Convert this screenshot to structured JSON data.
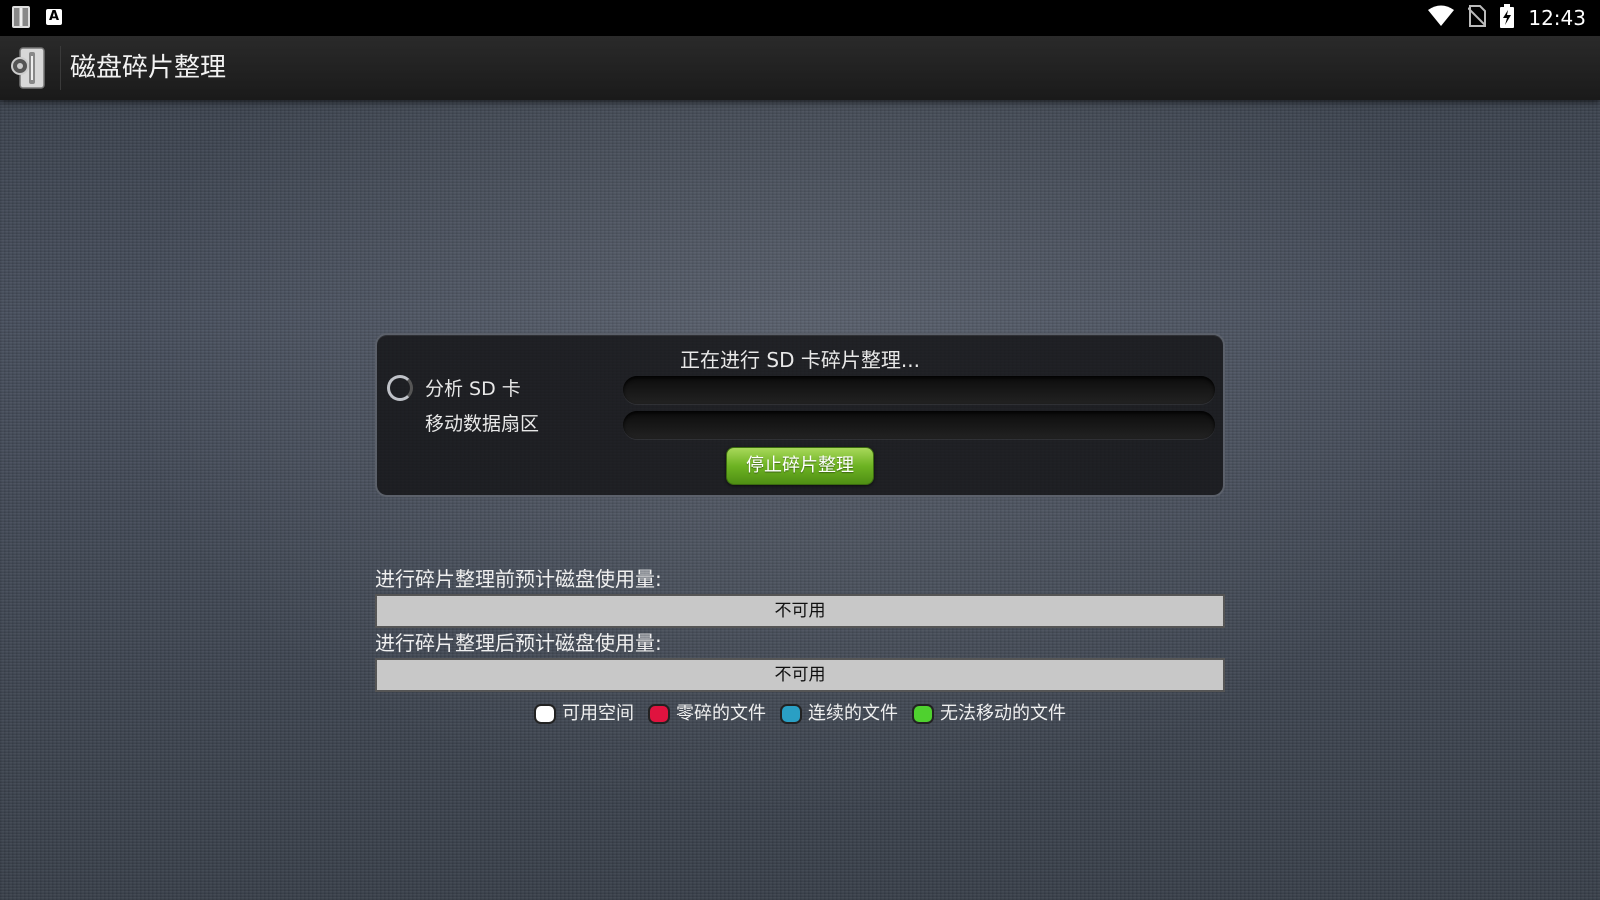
{
  "status_bar": {
    "time": "12:43",
    "left_icons": [
      "defrag-app-icon",
      "keyboard-a-icon"
    ],
    "right_icons": [
      "wifi-icon",
      "no-sim-icon",
      "battery-charging-icon"
    ]
  },
  "action_bar": {
    "title": "磁盘碎片整理",
    "icon": "defrag-app-icon"
  },
  "progress_panel": {
    "status_text": "正在进行 SD 卡碎片整理...",
    "rows": [
      {
        "label": "分析 SD 卡",
        "progress": 0
      },
      {
        "label": "移动数据扇区",
        "progress": 0
      }
    ],
    "stop_button_label": "停止碎片整理",
    "accent_color": "#6db322"
  },
  "disk_usage": {
    "before_label": "进行碎片整理前预计磁盘使用量:",
    "before_value": "不可用",
    "after_label": "进行碎片整理后预计磁盘使用量:",
    "after_value": "不可用"
  },
  "legend": [
    {
      "label": "可用空间",
      "color": "#ffffff"
    },
    {
      "label": "零碎的文件",
      "color": "#e0133f"
    },
    {
      "label": "连续的文件",
      "color": "#2a9fc4"
    },
    {
      "label": "无法移动的文件",
      "color": "#4fd12f"
    }
  ]
}
